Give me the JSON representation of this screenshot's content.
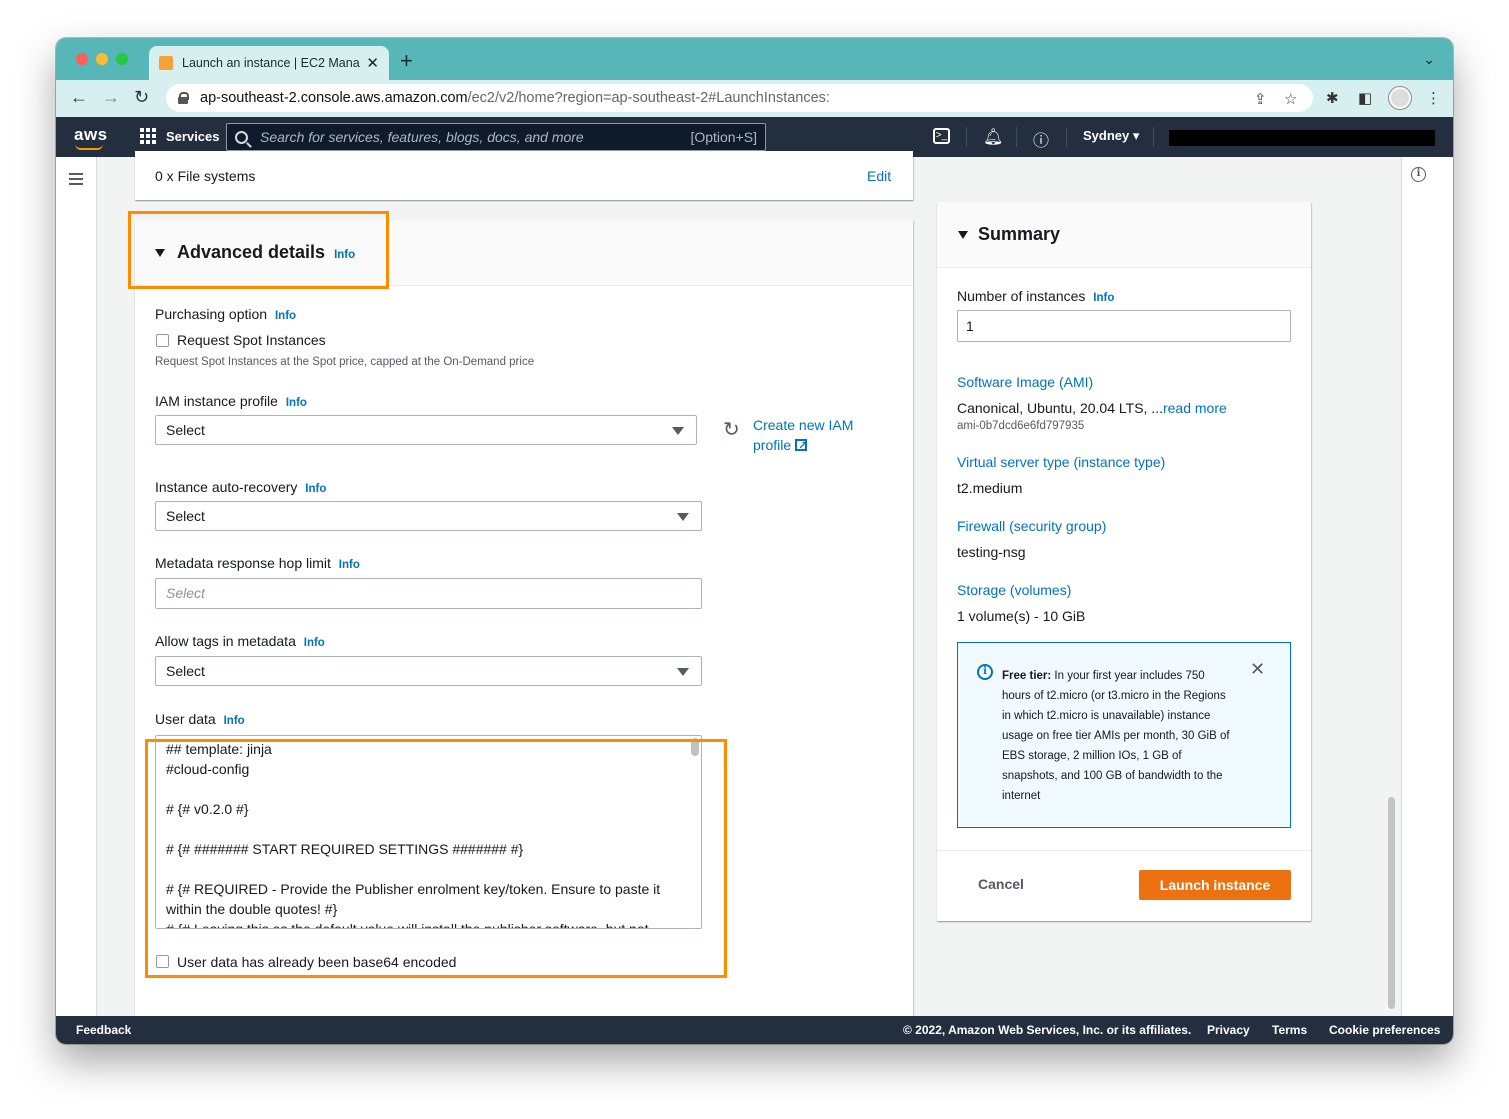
{
  "browser": {
    "tab_title": "Launch an instance | EC2 Mana",
    "new_tab": "+",
    "tab_close": "✕",
    "url_domain": "ap-southeast-2.console.aws.amazon.com",
    "url_path": "/ec2/v2/home?region=ap-southeast-2#LaunchInstances:",
    "icons": [
      "back-icon",
      "forward-icon",
      "reload-icon",
      "share-icon",
      "star-icon",
      "puzzle-icon",
      "sidepanel-icon",
      "menu-icon"
    ]
  },
  "awsnav": {
    "logo": "aws",
    "services": "Services",
    "search_placeholder": "Search for services, features, blogs, docs, and more",
    "search_shortcut": "[Option+S]",
    "region": "Sydney ▾"
  },
  "files": {
    "text": "0 x File systems",
    "edit": "Edit"
  },
  "advanced": {
    "title": "Advanced details",
    "info": "Info",
    "purchasing": {
      "label": "Purchasing option",
      "checkbox_label": "Request Spot Instances",
      "description": "Request Spot Instances at the Spot price, capped at the On-Demand price"
    },
    "iam": {
      "label": "IAM instance profile",
      "value": "Select",
      "create_link_1": "Create new IAM",
      "create_link_2": "profile"
    },
    "recovery": {
      "label": "Instance auto-recovery",
      "value": "Select"
    },
    "hop_limit": {
      "label": "Metadata response hop limit",
      "placeholder": "Select"
    },
    "tags": {
      "label": "Allow tags in metadata",
      "value": "Select"
    },
    "user_data": {
      "label": "User data",
      "lines": [
        "## template: jinja",
        "#cloud-config",
        "",
        "# {# v0.2.0 #}",
        "",
        "# {# ####### START REQUIRED SETTINGS ####### #}",
        "",
        "# {# REQUIRED - Provide the Publisher enrolment key/token. Ensure to paste it",
        "within the double quotes! #}",
        "# {# Leaving this as the default value will install the publisher software, but not"
      ],
      "base64_label": "User data has already been base64 encoded"
    }
  },
  "summary": {
    "title": "Summary",
    "instances_label": "Number of instances",
    "instances_value": "1",
    "ami_label": "Software Image (AMI)",
    "ami_value": "Canonical, Ubuntu, 20.04 LTS, ...",
    "ami_read_more": "read more",
    "ami_id": "ami-0b7dcd6e6fd797935",
    "instance_type_label": "Virtual server type (instance type)",
    "instance_type_value": "t2.medium",
    "firewall_label": "Firewall (security group)",
    "firewall_value": "testing-nsg",
    "storage_label": "Storage (volumes)",
    "storage_value": "1 volume(s) - 10 GiB",
    "free_tier_title": "Free tier:",
    "free_tier_text": " In your first year includes 750 hours of t2.micro (or t3.micro in the Regions in which t2.micro is unavailable) instance usage on free tier AMIs per month, 30 GiB of EBS storage, 2 million IOs, 1 GB of snapshots, and 100 GB of bandwidth to the internet",
    "cancel": "Cancel",
    "launch": "Launch instance"
  },
  "footer": {
    "feedback": "Feedback",
    "copyright": "© 2022, Amazon Web Services, Inc. or its affiliates.",
    "privacy": "Privacy",
    "terms": "Terms",
    "cookies": "Cookie preferences"
  },
  "colors": {
    "highlight": "#ff8c00",
    "link": "#0073bb",
    "primary_button": "#ec7211",
    "nav_bg": "#232f3e"
  }
}
